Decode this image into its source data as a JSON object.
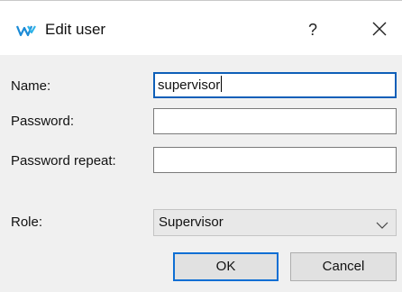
{
  "dialog": {
    "title": "Edit user",
    "help_label": "?",
    "close_icon": "close-icon",
    "app_icon": "app-logo-icon",
    "accent_color": "#0e6fd4"
  },
  "form": {
    "name": {
      "label": "Name:",
      "value": "supervisor"
    },
    "password": {
      "label": "Password:",
      "value": ""
    },
    "password_repeat": {
      "label": "Password repeat:",
      "value": ""
    },
    "role": {
      "label": "Role:",
      "selected": "Supervisor",
      "dropdown_icon": "chevron-down-icon"
    }
  },
  "buttons": {
    "ok_label": "OK",
    "cancel_label": "Cancel"
  }
}
